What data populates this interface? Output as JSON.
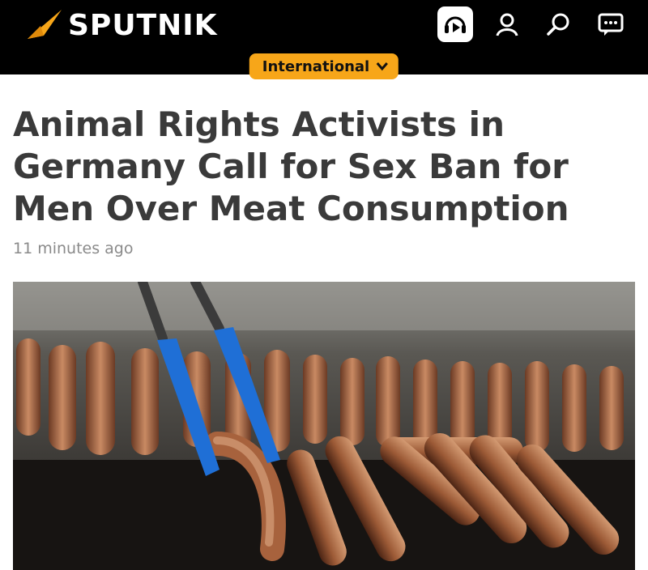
{
  "brand": {
    "name": "SPUTNIK",
    "accent": "#f7a619"
  },
  "header": {
    "icons": [
      "radio-icon",
      "user-icon",
      "search-icon",
      "chat-icon"
    ]
  },
  "category": {
    "label": "International"
  },
  "article": {
    "title": "Animal Rights Activists in Germany Call for Sex Ban for Men Over Meat Consumption",
    "time": "11 minutes ago"
  },
  "colors": {
    "header_bg": "#000000",
    "title": "#3a3a3a",
    "meta": "#8a8a8a",
    "tongs": "#1f6fd6"
  }
}
